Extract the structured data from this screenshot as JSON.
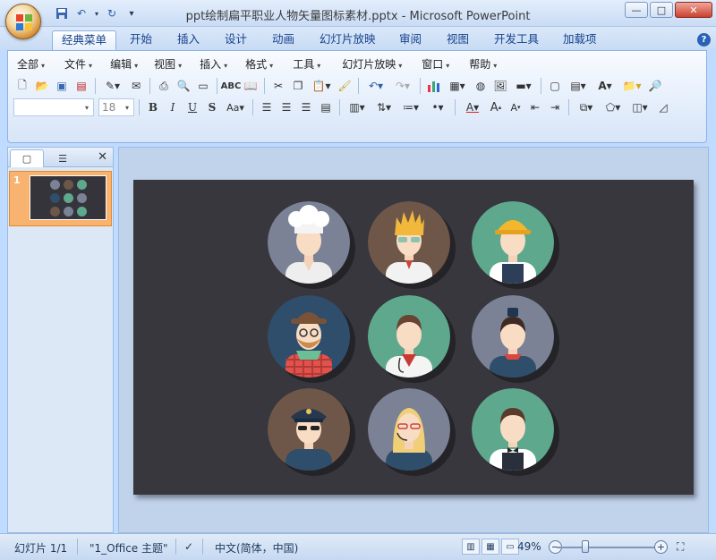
{
  "window": {
    "title": "ppt绘制扁平职业人物矢量图标素材.pptx - Microsoft PowerPoint",
    "minimize": "—",
    "maximize": "□",
    "close": "✕"
  },
  "quick_access": {
    "save_icon": "save-icon",
    "undo_icon": "undo-icon",
    "redo_icon": "redo-icon",
    "customize": "▾"
  },
  "tabs": [
    {
      "label": "经典菜单",
      "active": true
    },
    {
      "label": "开始"
    },
    {
      "label": "插入"
    },
    {
      "label": "设计"
    },
    {
      "label": "动画"
    },
    {
      "label": "幻灯片放映"
    },
    {
      "label": "审阅"
    },
    {
      "label": "视图"
    },
    {
      "label": "开发工具"
    },
    {
      "label": "加载项"
    }
  ],
  "classic_menu": [
    "全部",
    "文件",
    "编辑",
    "视图",
    "插入",
    "格式",
    "工具",
    "幻灯片放映",
    "窗口",
    "帮助"
  ],
  "font": {
    "name": "",
    "size": "18"
  },
  "left_pane": {
    "slide_number": "1",
    "close": "✕"
  },
  "status": {
    "slide_info": "幻灯片 1/1",
    "theme": "\"1_Office 主题\"",
    "language": "中文(简体，中国)",
    "zoom": "49%",
    "zoom_level": 0.49
  },
  "colors": {
    "slide_bg": "#38373d",
    "avatar_grey": "#7b8295",
    "avatar_brown": "#6e5748",
    "avatar_green": "#5ea98e",
    "avatar_navy": "#2f4e6b"
  }
}
